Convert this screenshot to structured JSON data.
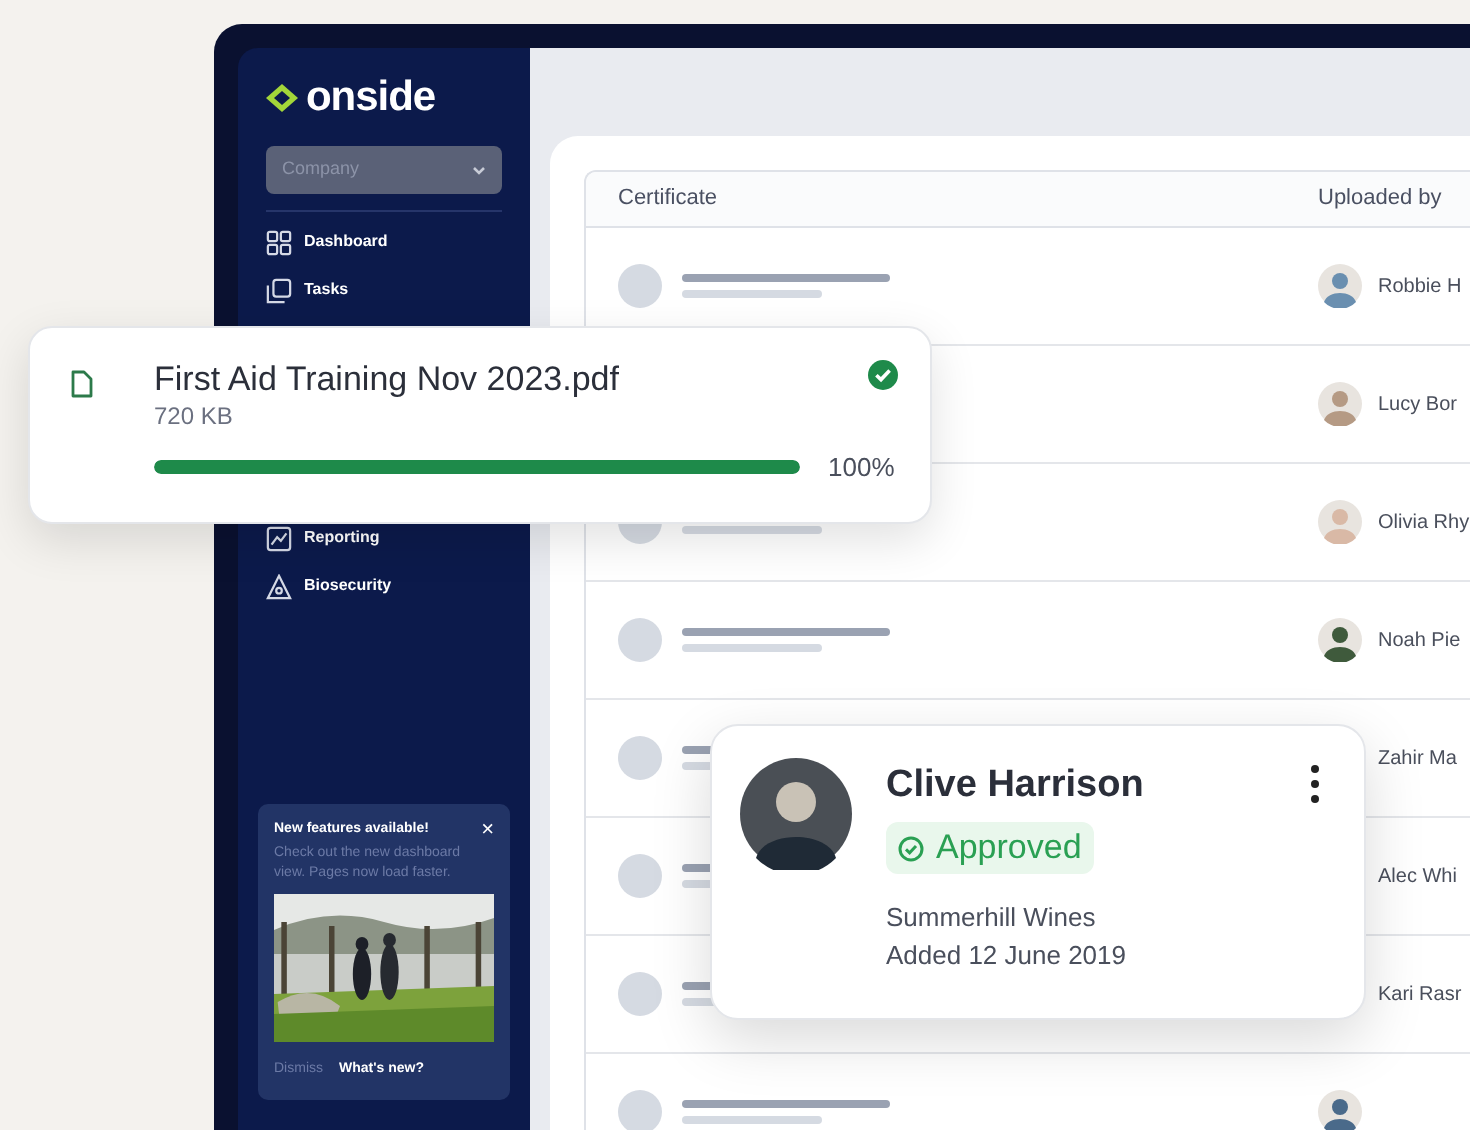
{
  "brand": {
    "name": "onside"
  },
  "sidebar": {
    "company_select": {
      "placeholder": "Company"
    },
    "nav_items": [
      {
        "label": "Dashboard",
        "kind": "dashboard"
      },
      {
        "label": "Tasks",
        "kind": "tasks"
      },
      {
        "label": "Reporting",
        "kind": "reporting"
      },
      {
        "label": "Biosecurity",
        "kind": "biosecurity"
      }
    ],
    "notice": {
      "title": "New features available!",
      "close": "×",
      "body": "Check out the new dashboard view. Pages now load faster.",
      "actions": [
        {
          "label": "Dismiss",
          "primary": false
        },
        {
          "label": "What's new?",
          "primary": true
        }
      ]
    }
  },
  "table": {
    "columns": [
      "Certificate",
      "Uploaded by"
    ],
    "rows": [
      {
        "uploaded_by": "Robbie H"
      },
      {
        "uploaded_by": "Lucy Bor"
      },
      {
        "uploaded_by": "Olivia Rhy"
      },
      {
        "uploaded_by": "Noah Pie"
      },
      {
        "uploaded_by": "Zahir Ma"
      },
      {
        "uploaded_by": "Alec Whi"
      },
      {
        "uploaded_by": "Kari Rasr"
      }
    ]
  },
  "upload": {
    "file_name": "First Aid Training Nov 2023.pdf",
    "size": "720 KB",
    "level": 1,
    "percent": "100%",
    "complete": true
  },
  "profile_card": {
    "name": "Clive Harrison",
    "status": "Approved",
    "company": "Summerhill Wines",
    "added": "Added 12 June 2019"
  }
}
